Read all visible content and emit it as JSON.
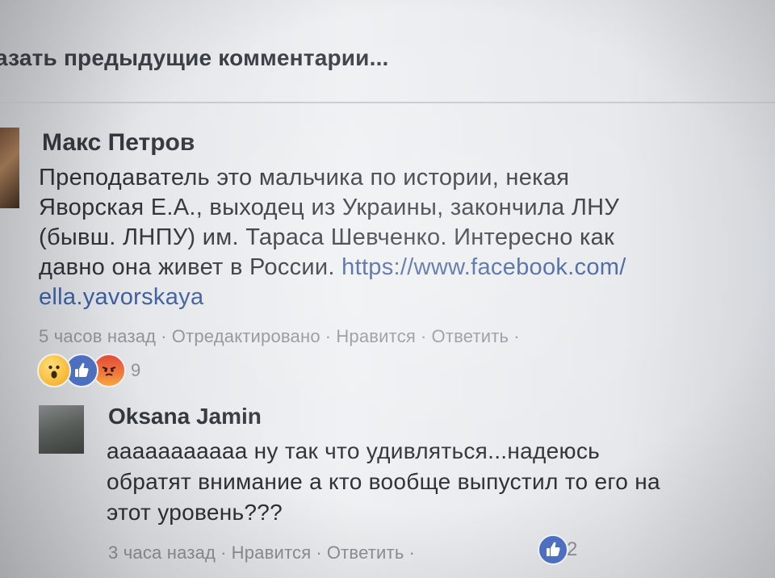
{
  "show_previous": "азать предыдущие комментарии...",
  "comments": [
    {
      "author": "Макс Петров",
      "lines": [
        "Преподаватель это мальчика по истории, некая",
        "Яворская  Е.А., выходец из Украины, закончила ЛНУ",
        "(бывш. ЛНПУ) им. Тараса Шевченко. Интересно как",
        "давно она живет в России."
      ],
      "link_part1": "https://www.facebook.com/",
      "link_part2": "ella.yavorskaya",
      "time": "5 часов назад",
      "edited": "Отредактировано",
      "like": "Нравится",
      "reply": "Ответить",
      "reaction_icons": [
        "wow-icon",
        "like-icon",
        "angry-icon"
      ],
      "reaction_count": "9"
    },
    {
      "author": "Oksana Jamin",
      "lines": [
        "ааааааааааа ну так что удивляться...надеюсь",
        "обратят внимание а кто вообще выпустил то его на",
        "этот уровень???"
      ],
      "time": "3 часа назад",
      "like": "Нравится",
      "reply": "Ответить",
      "reaction_icons": [
        "like-icon"
      ],
      "reaction_count": "2"
    }
  ],
  "colors": {
    "link": "#3b5b9a",
    "like_reaction": "#4c6fbf",
    "meta_text": "#8e9197"
  }
}
